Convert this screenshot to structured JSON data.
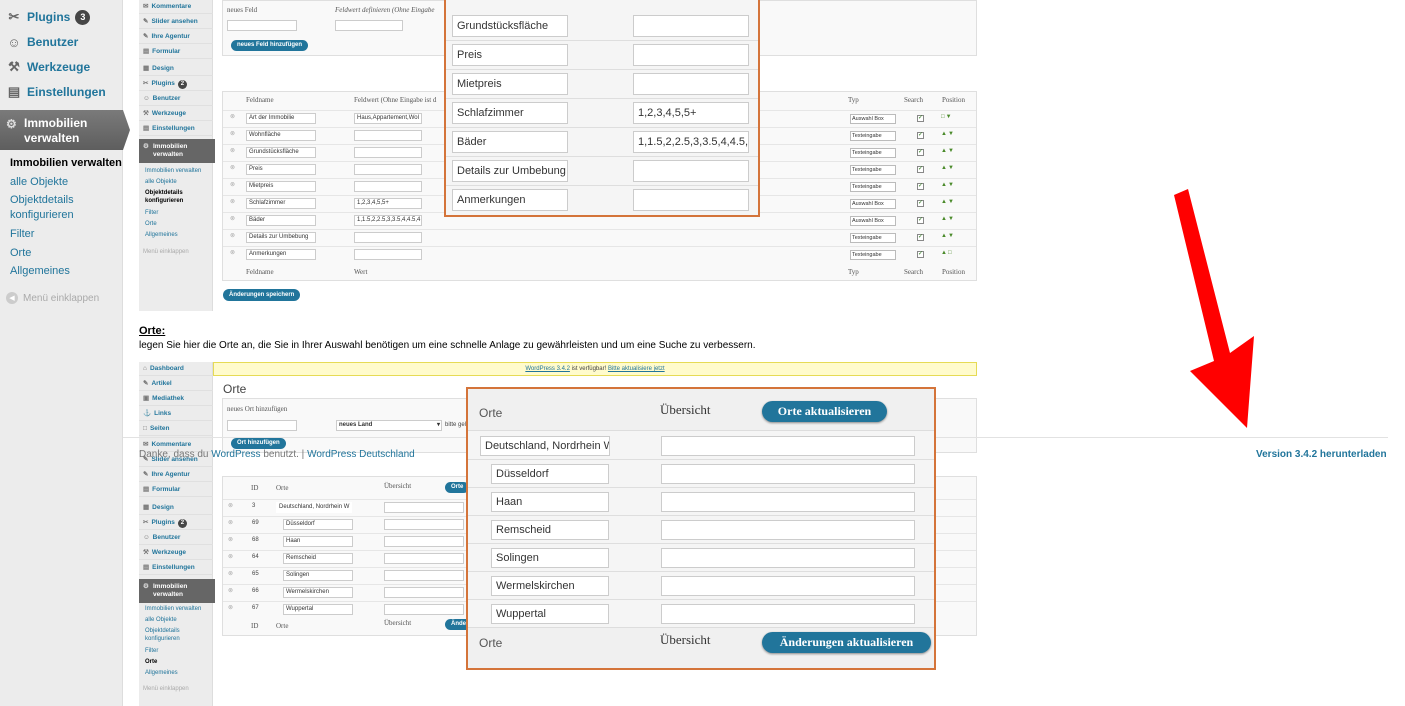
{
  "sidebar": {
    "items": [
      {
        "label": "Plugins",
        "icon": "plugin-icon",
        "badge": "3"
      },
      {
        "label": "Benutzer",
        "icon": "users-icon"
      },
      {
        "label": "Werkzeuge",
        "icon": "tools-icon"
      },
      {
        "label": "Einstellungen",
        "icon": "settings-icon"
      }
    ],
    "active": {
      "label_line1": "Immobilien",
      "label_line2": "verwalten",
      "icon": "gear-icon"
    },
    "submenu": [
      "Immobilien verwalten",
      "alle Objekte",
      "Objektdetails",
      "konfigurieren",
      "Filter",
      "Orte",
      "Allgemeines"
    ],
    "collapse": "Menü einklappen"
  },
  "mini_sidebar_top": {
    "items": [
      "Kommentare",
      "Slider ansehen",
      "Ihre Agentur",
      "Formular",
      "Design",
      "Plugins",
      "Benutzer",
      "Werkzeuge",
      "Einstellungen"
    ],
    "plugins_badge": "2",
    "active": [
      "Immobilien",
      "verwalten"
    ],
    "submenu": [
      "Immobilien verwalten",
      "alle Objekte",
      "Objektdetails",
      "konfigurieren",
      "Filter",
      "Orte",
      "Allgemeines"
    ],
    "collapse": "Menü einklappen"
  },
  "mini_sidebar_bottom": {
    "items": [
      "Dashboard",
      "Artikel",
      "Mediathek",
      "Links",
      "Seiten",
      "Kommentare",
      "Slider ansehen",
      "Ihre Agentur",
      "Formular",
      "Design",
      "Plugins",
      "Benutzer",
      "Werkzeuge",
      "Einstellungen"
    ],
    "plugins_badge": "2",
    "active": [
      "Immobilien",
      "verwalten"
    ],
    "submenu": [
      "Immobilien verwalten",
      "alle Objekte",
      "Objektdetails",
      "konfigurieren",
      "Filter",
      "Orte",
      "Allgemeines"
    ],
    "collapse": "Menü einklappen"
  },
  "fields_panel": {
    "new_field_label": "neues Feld",
    "define_label": "Feldwert definieren (Ohne Eingabe",
    "add_button": "neues Feld hinzufügen",
    "col_name": "Feldname",
    "col_value": "Feldwert (Ohne Eingabe ist d",
    "col_type": "Typ",
    "col_search": "Search",
    "col_position": "Position",
    "foot_name": "Feldname",
    "foot_value": "Wert",
    "rows": [
      {
        "name": "Art der Immobilie",
        "value": "Haus,Appartement,Wol",
        "type": "Auswahl Box"
      },
      {
        "name": "Wohnfläche",
        "value": "",
        "type": "Texteingabe"
      },
      {
        "name": "Grundstücksfläche",
        "value": "",
        "type": "Texteingabe"
      },
      {
        "name": "Preis",
        "value": "",
        "type": "Texteingabe"
      },
      {
        "name": "Mietpreis",
        "value": "",
        "type": "Texteingabe"
      },
      {
        "name": "Schlafzimmer",
        "value": "1,2,3,4,5,5+",
        "type": "Auswahl Box"
      },
      {
        "name": "Bäder",
        "value": "1,1.5,2,2.5,3,3.5,4,4.5,4",
        "type": "Auswahl Box"
      },
      {
        "name": "Details zur Umbebung",
        "value": "",
        "type": "Texteingabe"
      },
      {
        "name": "Anmerkungen",
        "value": "",
        "type": "Texteingabe"
      }
    ],
    "save_button": "Änderungen speichern"
  },
  "zoom_fields": {
    "rows": [
      {
        "name": "Grundstücksfläche",
        "value": ""
      },
      {
        "name": "Preis",
        "value": ""
      },
      {
        "name": "Mietpreis",
        "value": ""
      },
      {
        "name": "Schlafzimmer",
        "value": "1,2,3,4,5,5+"
      },
      {
        "name": "Bäder",
        "value": "1,1.5,2,2.5,3,3.5,4,4.5,4"
      },
      {
        "name": "Details zur Umbebung",
        "value": ""
      },
      {
        "name": "Anmerkungen",
        "value": ""
      }
    ]
  },
  "orte_section": {
    "heading": "Orte:",
    "description": "legen Sie hier die Orte an, die Sie in Ihrer Auswahl benötigen um eine schnelle Anlage zu gewährleisten und um eine Suche zu verbessern."
  },
  "notice": {
    "link1": "WordPress 3.4.2",
    "text": " ist verfügbar! ",
    "link2": "Bitte aktualisiere jetzt"
  },
  "orte_panel": {
    "title": "Orte",
    "new_label": "neues Ort hinzufügen",
    "select_value": "neues Land",
    "hint": "bitte gel",
    "add_button": "Ort hinzufügen",
    "col_id": "ID",
    "col_orte": "Orte",
    "col_overview": "Übersicht",
    "header_button": "Orte",
    "footer_button": "Ände",
    "rows": [
      {
        "id": "3",
        "name": "Deutschland, Nordrhein W"
      },
      {
        "id": "69",
        "name": "Düsseldorf"
      },
      {
        "id": "68",
        "name": "Haan"
      },
      {
        "id": "64",
        "name": "Remscheid"
      },
      {
        "id": "65",
        "name": "Solingen"
      },
      {
        "id": "66",
        "name": "Wermelskirchen"
      },
      {
        "id": "67",
        "name": "Wuppertal"
      }
    ]
  },
  "zoom_orte": {
    "header_orte": "Orte",
    "header_overview": "Übersicht",
    "update_button": "Orte aktualisieren",
    "rows": [
      "Deutschland, Nordrhein W",
      "Düsseldorf",
      "Haan",
      "Remscheid",
      "Solingen",
      "Wermelskirchen",
      "Wuppertal"
    ],
    "footer_orte": "Orte",
    "footer_overview": "Übersicht",
    "save_button": "Änderungen aktualisieren"
  },
  "footer": {
    "thanks_prefix": "Danke, dass du ",
    "wp_link": "WordPress",
    "thanks_mid": " benutzt. | ",
    "wp_de_link": "WordPress Deutschland",
    "version_link": "Version 3.4.2 herunterladen"
  },
  "colors": {
    "accent": "#21759b",
    "zoom_border": "#d4743a",
    "arrow": "#ff0000"
  }
}
